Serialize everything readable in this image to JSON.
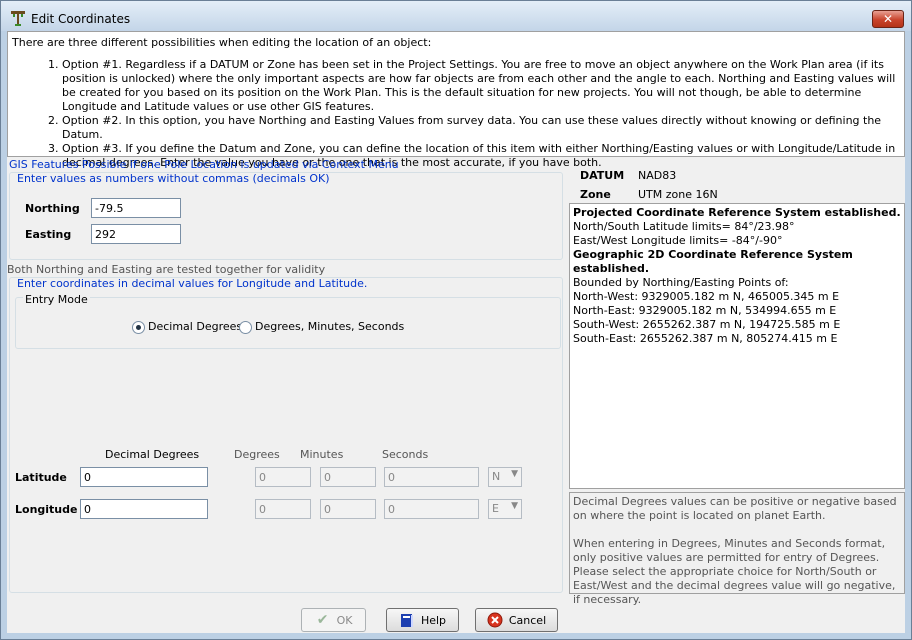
{
  "window": {
    "title": "Edit Coordinates",
    "close_symbol": "✕",
    "title_icon": "survey-pole-icon"
  },
  "intro": {
    "lead": "There are three different possibilities when editing the location of an object:",
    "options": [
      "Option #1. Regardless if a DATUM or Zone has been set in the Project Settings. You are free to move an object anywhere on the Work Plan area (if its position is unlocked) where the only important aspects are how far objects are from each other and the angle to each. Northing and Easting values will be created for you based on its position on the Work Plan. This is the default situation for new projects. You will not though, be able to determine Longitude and Latitude values or use other GIS features.",
      "Option #2. In this option, you have Northing and Easting Values from survey data. You can use these values directly without knowing or defining the Datum.",
      "Option #3. If you define the Datum and Zone, you can define the location of this item with either Northing/Easting values or with Longitude/Latitude in decimal degrees. Enter the value you have or the one that is the most accurate, if you have both."
    ]
  },
  "gis_note": "GIS Features Possible if one Pole Location is updated via Context Menu",
  "ne_group": {
    "caption": "Enter values as numbers without commas (decimals OK)",
    "northing_label": "Northing",
    "northing_value": "-79.5",
    "easting_label": "Easting",
    "easting_value": "292"
  },
  "validity_note": "Both Northing and Easting are tested together for validity",
  "ll_group": {
    "caption": "Enter coordinates in decimal values for Longitude and Latitude.",
    "entry_mode_label": "Entry Mode",
    "mode_decimal": "Decimal Degrees",
    "mode_dms": "Degrees, Minutes, Seconds",
    "selected_mode": "decimal",
    "col_decimal": "Decimal Degrees",
    "col_degrees": "Degrees",
    "col_minutes": "Minutes",
    "col_seconds": "Seconds",
    "latitude_label": "Latitude",
    "latitude_decimal": "0",
    "latitude_deg": "0",
    "latitude_min": "0",
    "latitude_sec": "0",
    "latitude_dir": "N",
    "longitude_label": "Longitude",
    "longitude_decimal": "0",
    "longitude_deg": "0",
    "longitude_min": "0",
    "longitude_sec": "0",
    "longitude_dir": "E"
  },
  "datum": {
    "datum_label": "DATUM",
    "datum_value": "NAD83",
    "zone_label": "Zone",
    "zone_value": "UTM zone 16N"
  },
  "crs_info": {
    "projected_header": "Projected Coordinate Reference System established.",
    "ns_limits": "North/South Latitude limits= 84°/23.98°",
    "ew_limits": "East/West Longitude limits= -84°/-90°",
    "geographic_header": "Geographic 2D Coordinate Reference System established.",
    "bounded_by": "Bounded by Northing/Easting Points of:",
    "north_west": "North-West: 9329005.182 m N, 465005.345 m E",
    "north_east": "North-East: 9329005.182 m N, 534994.655 m E",
    "south_west": "South-West: 2655262.387 m N, 194725.585 m E",
    "south_east": "South-East: 2655262.387 m N, 805274.415 m E"
  },
  "help_note": {
    "para1": "Decimal Degrees values can be positive or negative based on where the point is located on planet Earth.",
    "para2": "When entering in Degrees, Minutes and Seconds format, only positive values are permitted for entry of Degrees. Please select the appropriate choice for North/South or East/West and the decimal degrees value will go negative, if necessary."
  },
  "buttons": {
    "ok_label": "OK",
    "help_label": "Help",
    "cancel_label": "Cancel"
  }
}
